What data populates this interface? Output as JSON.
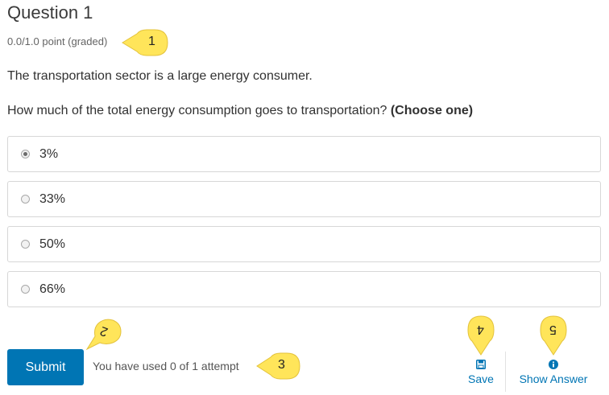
{
  "question": {
    "title": "Question 1",
    "points": "0.0/1.0 point (graded)",
    "statement": "The transportation sector is a large energy consumer.",
    "prompt": "How much of the total energy consumption goes to transportation?",
    "prompt_emphasis": "(Choose one)"
  },
  "choices": [
    {
      "label": "3%",
      "selected": true
    },
    {
      "label": "33%",
      "selected": false
    },
    {
      "label": "50%",
      "selected": false
    },
    {
      "label": "66%",
      "selected": false
    }
  ],
  "actions": {
    "submit_label": "Submit",
    "attempts_text": "You have used 0 of 1 attempt",
    "save_label": "Save",
    "show_answer_label": "Show Answer"
  },
  "callouts": [
    "1",
    "2",
    "3",
    "4",
    "5"
  ],
  "colors": {
    "accent": "#0075b4",
    "callout": "#ffe55a"
  }
}
